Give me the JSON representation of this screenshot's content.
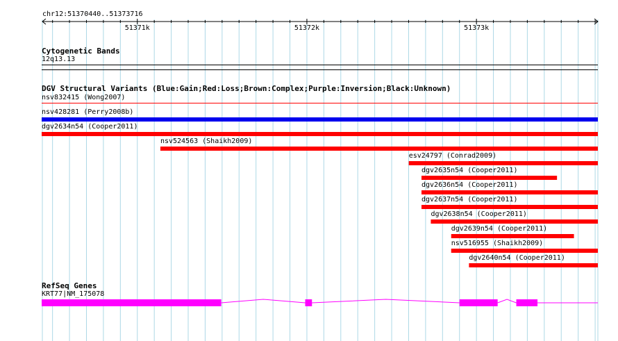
{
  "ruler": {
    "region_label": "chr12:51370440..51373716",
    "start": 51370440,
    "end": 51373716,
    "major_ticks": [
      {
        "pos": 51371000,
        "label": "51371k"
      },
      {
        "pos": 51372000,
        "label": "51372k"
      },
      {
        "pos": 51373000,
        "label": "51373k"
      }
    ]
  },
  "cytoband": {
    "title": "Cytogenetic Bands",
    "band": "12q13.13"
  },
  "dgv": {
    "title": "DGV Structural Variants (Blue:Gain;Red:Loss;Brown:Complex;Purple:Inversion;Black:Unknown)",
    "features": [
      {
        "label": "nsv832415 (Wong2007)",
        "type": "loss",
        "start": 51370440,
        "end": 51373716,
        "style": "thin"
      },
      {
        "label": "nsv428281 (Perry2008b)",
        "type": "gain",
        "start": 51370440,
        "end": 51373716,
        "style": "bar"
      },
      {
        "label": "dgv2634n54 (Cooper2011)",
        "type": "loss",
        "start": 51370440,
        "end": 51373716,
        "style": "bar"
      },
      {
        "label": "nsv524563 (Shaikh2009)",
        "type": "loss",
        "start": 51371140,
        "end": 51373716,
        "style": "bar"
      },
      {
        "label": "esv24797 (Conrad2009)",
        "type": "loss",
        "start": 51372605,
        "end": 51373716,
        "style": "bar"
      },
      {
        "label": "dgv2635n54 (Cooper2011)",
        "type": "loss",
        "start": 51372680,
        "end": 51373475,
        "style": "bar"
      },
      {
        "label": "dgv2636n54 (Cooper2011)",
        "type": "loss",
        "start": 51372680,
        "end": 51373716,
        "style": "bar"
      },
      {
        "label": "dgv2637n54 (Cooper2011)",
        "type": "loss",
        "start": 51372680,
        "end": 51373716,
        "style": "bar"
      },
      {
        "label": "dgv2638n54 (Cooper2011)",
        "type": "loss",
        "start": 51372735,
        "end": 51373716,
        "style": "bar"
      },
      {
        "label": "dgv2639n54 (Cooper2011)",
        "type": "loss",
        "start": 51372855,
        "end": 51373575,
        "style": "bar"
      },
      {
        "label": "nsv516955 (Shaikh2009)",
        "type": "loss",
        "start": 51372855,
        "end": 51373716,
        "style": "bar"
      },
      {
        "label": "dgv2640n54 (Cooper2011)",
        "type": "loss",
        "start": 51372960,
        "end": 51373716,
        "style": "bar"
      }
    ]
  },
  "refseq": {
    "title": "RefSeq Genes",
    "gene_label": "KRT77|NM_175078",
    "start": 51370440,
    "end": 51373716,
    "exons": [
      [
        51370440,
        51371495
      ],
      [
        51371990,
        51372030
      ],
      [
        51372900,
        51373125
      ],
      [
        51373235,
        51373360
      ]
    ]
  },
  "colors": {
    "gain": "#0000ee",
    "loss": "#ff0000",
    "gene": "#ff00ff",
    "grid": "#add8e6"
  }
}
